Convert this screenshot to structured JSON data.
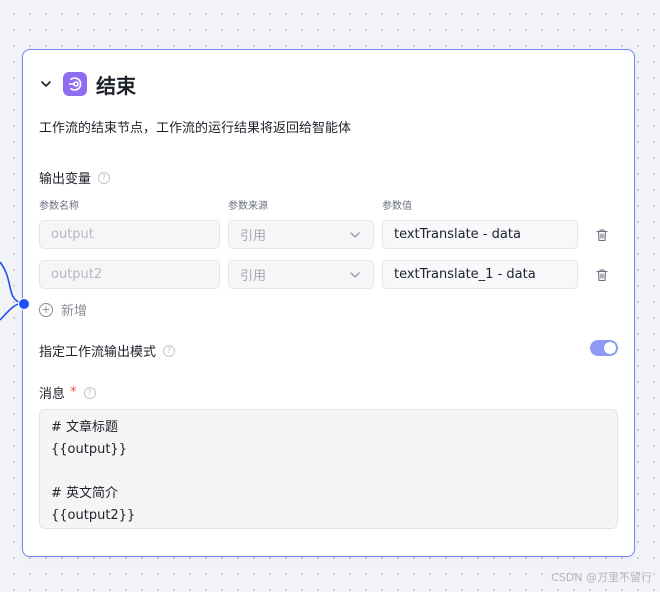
{
  "node": {
    "title": "结束",
    "description": "工作流的结束节点，工作流的运行结果将返回给智能体"
  },
  "outputs": {
    "section_label": "输出变量",
    "columns": {
      "name": "参数名称",
      "source": "参数来源",
      "value": "参数值"
    },
    "rows": [
      {
        "name_placeholder": "output",
        "source": "引用",
        "value": "textTranslate - data"
      },
      {
        "name_placeholder": "output2",
        "source": "引用",
        "value": "textTranslate_1 - data"
      }
    ],
    "add_label": "新增"
  },
  "output_mode": {
    "label": "指定工作流输出模式",
    "enabled": true
  },
  "message": {
    "label": "消息",
    "required_mark": "*",
    "content": "# 文章标题\n{{output}}\n\n# 英文简介\n{{output2}}"
  },
  "help_glyph": "?",
  "add_glyph": "+",
  "icons": {
    "collapse": "chevron-down-icon",
    "node": "end-node-icon",
    "help": "help-circle-icon",
    "delete": "trash-icon",
    "add": "plus-circle-icon",
    "select": "chevron-down-icon"
  },
  "colors": {
    "card_border": "#6f86ee",
    "node_icon_bg": "#8f6cf0",
    "edge": "#1f4ff5",
    "toggle_on": "#8f9af2",
    "required": "#f54a45"
  },
  "watermark": "CSDN @万里不留行"
}
